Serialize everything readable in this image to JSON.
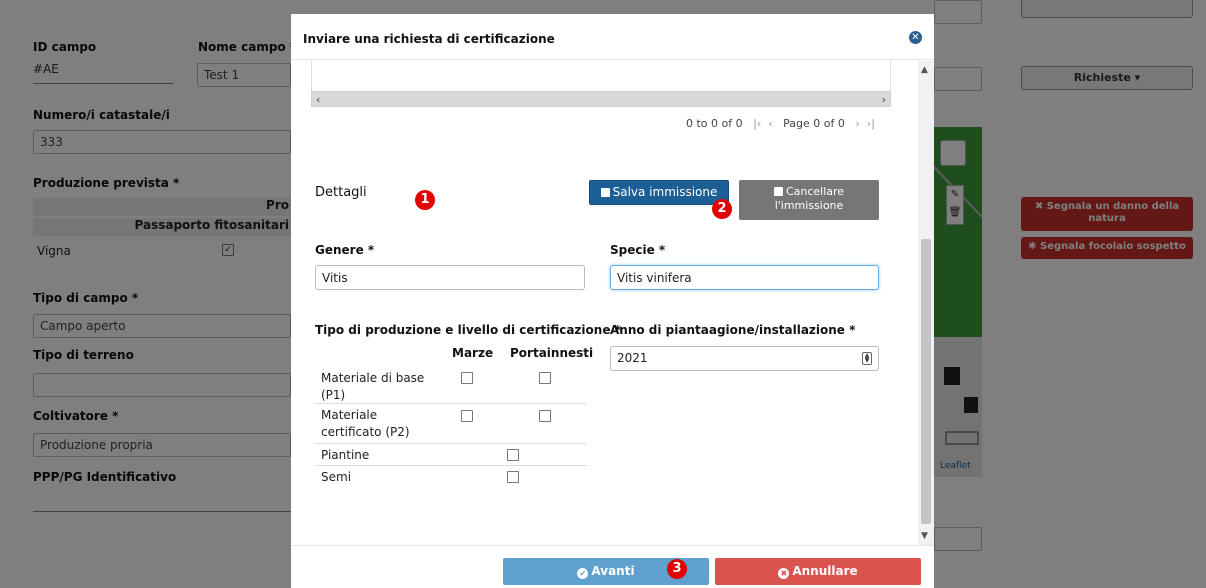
{
  "background": {
    "id_label": "ID campo",
    "id_value": "#AE",
    "name_label": "Nome campo *",
    "name_value": "Test 1",
    "cadastral_label": "Numero/i catastale/i",
    "cadastral_value": "333",
    "production_label": "Produzione prevista *",
    "production_group_header": "Pro",
    "passport_header": "Passaporto fitosanitari",
    "row_crop": "Vigna",
    "field_type_label": "Tipo di campo *",
    "field_type_value": "Campo aperto",
    "soil_type_label": "Tipo di terreno",
    "soil_type_value": "",
    "grower_label": "Coltivatore *",
    "grower_value": "Produzione propria",
    "ppp_label": "PPP/PG Identificativo",
    "requests_button": "Richieste ▾",
    "report_damage_button": "✖ Segnala un danno della natura",
    "report_outbreak_button": "✱ Segnala focolaio sospetto",
    "map_attribution": "Leaflet"
  },
  "modal": {
    "title": "Inviare una richiesta di certificazione",
    "pager": {
      "range": "0 to 0 of 0",
      "page": "Page 0 of 0"
    },
    "details_title": "Dettagli",
    "save_button": "Salva immissione",
    "delete_button": "Cancellare l'immissione",
    "genus_label": "Genere *",
    "genus_value": "Vitis",
    "species_label": "Specie *",
    "species_value": "Vitis vinifera",
    "cert_label": "Tipo di produzione e livello di certificazione *",
    "year_label": "Anno di piantaagione/installazione *",
    "year_value": "2021",
    "cert_columns": [
      "Marze",
      "Portainnesti"
    ],
    "cert_rows": [
      "Materiale di base (P1)",
      "Materiale certificato (P2)",
      "Piantine",
      "Semi"
    ],
    "next_button": "Avanti",
    "cancel_button": "Annullare"
  },
  "annotations": [
    "1",
    "2",
    "3"
  ],
  "colors": {
    "primary": "#1c5e96",
    "next": "#5fa0ce",
    "cancel": "#d9534f",
    "badge": "#e30000"
  }
}
